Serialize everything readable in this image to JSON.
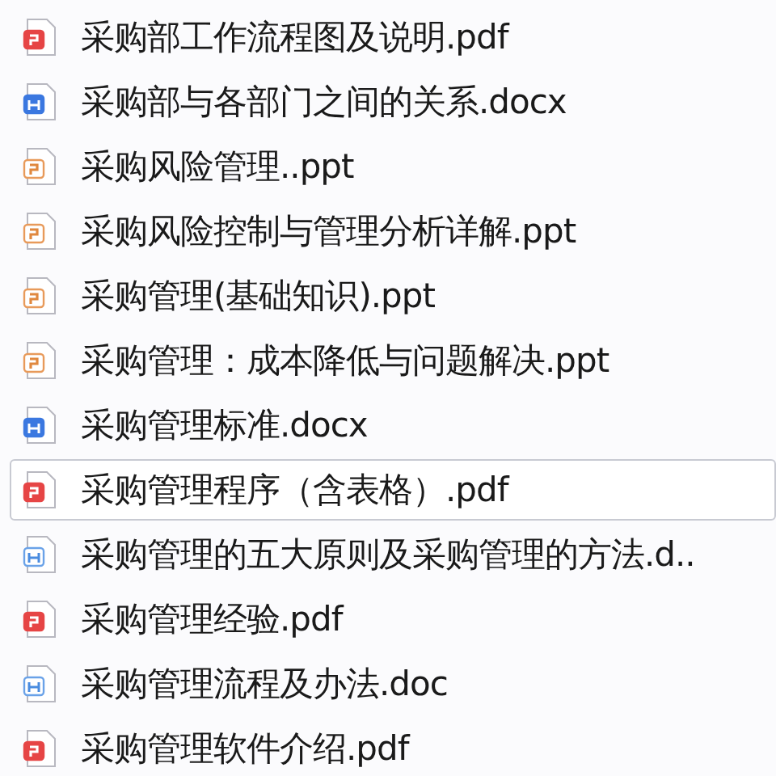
{
  "files": [
    {
      "name": "采购部工作流程图及说明.pdf",
      "kind": "pdf",
      "selected": false
    },
    {
      "name": "采购部与各部门之间的关系.docx",
      "kind": "docx",
      "selected": false
    },
    {
      "name": "采购风险管理..ppt",
      "kind": "ppt",
      "selected": false
    },
    {
      "name": "采购风险控制与管理分析详解.ppt",
      "kind": "ppt",
      "selected": false
    },
    {
      "name": "采购管理(基础知识).ppt",
      "kind": "ppt",
      "selected": false
    },
    {
      "name": "采购管理：成本降低与问题解决.ppt",
      "kind": "ppt",
      "selected": false
    },
    {
      "name": "采购管理标准.docx",
      "kind": "docx",
      "selected": false
    },
    {
      "name": "采购管理程序（含表格）.pdf",
      "kind": "pdf",
      "selected": true
    },
    {
      "name": "采购管理的五大原则及采购管理的方法.d..",
      "kind": "doc",
      "selected": false
    },
    {
      "name": "采购管理经验.pdf",
      "kind": "pdf",
      "selected": false
    },
    {
      "name": "采购管理流程及办法.doc",
      "kind": "doc",
      "selected": false
    },
    {
      "name": "采购管理软件介绍.pdf",
      "kind": "pdf",
      "selected": false
    }
  ]
}
